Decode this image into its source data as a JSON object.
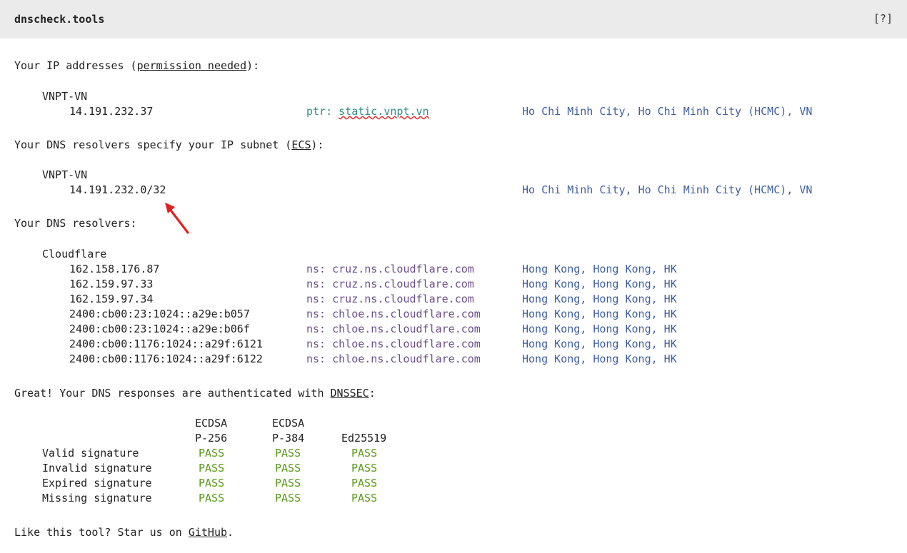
{
  "header": {
    "brand": "dnscheck.tools",
    "help": "[?]"
  },
  "ip_section": {
    "heading_before": "Your IP addresses (",
    "heading_link": "permission needed",
    "heading_after": "):",
    "provider": "VNPT-VN",
    "ip": "14.191.232.37",
    "ptr_label": "ptr: ",
    "ptr_value": "static.vnpt.vn",
    "location": "Ho Chi Minh City, Ho Chi Minh City (HCMC), VN"
  },
  "ecs_section": {
    "heading_before": "Your DNS resolvers specify your IP subnet (",
    "heading_link": "ECS",
    "heading_after": "):",
    "provider": "VNPT-VN",
    "subnet": "14.191.232.0/32",
    "location": "Ho Chi Minh City, Ho Chi Minh City (HCMC), VN"
  },
  "resolvers_section": {
    "heading": "Your DNS resolvers:",
    "provider": "Cloudflare",
    "rows": [
      {
        "ip": "162.158.176.87",
        "ns": "ns: cruz.ns.cloudflare.com",
        "location": "Hong Kong, Hong Kong, HK"
      },
      {
        "ip": "162.159.97.33",
        "ns": "ns: cruz.ns.cloudflare.com",
        "location": "Hong Kong, Hong Kong, HK"
      },
      {
        "ip": "162.159.97.34",
        "ns": "ns: cruz.ns.cloudflare.com",
        "location": "Hong Kong, Hong Kong, HK"
      },
      {
        "ip": "2400:cb00:23:1024::a29e:b057",
        "ns": "ns: chloe.ns.cloudflare.com",
        "location": "Hong Kong, Hong Kong, HK"
      },
      {
        "ip": "2400:cb00:23:1024::a29e:b06f",
        "ns": "ns: chloe.ns.cloudflare.com",
        "location": "Hong Kong, Hong Kong, HK"
      },
      {
        "ip": "2400:cb00:1176:1024::a29f:6121",
        "ns": "ns: chloe.ns.cloudflare.com",
        "location": "Hong Kong, Hong Kong, HK"
      },
      {
        "ip": "2400:cb00:1176:1024::a29f:6122",
        "ns": "ns: chloe.ns.cloudflare.com",
        "location": "Hong Kong, Hong Kong, HK"
      }
    ]
  },
  "dnssec_section": {
    "heading_before": "Great! Your DNS responses are authenticated with ",
    "heading_link": "DNSSEC",
    "heading_after": ":",
    "columns": [
      {
        "line1": "ECDSA",
        "line2": "P-256"
      },
      {
        "line1": "ECDSA",
        "line2": "P-384"
      },
      {
        "line1": "",
        "line2": "Ed25519"
      }
    ],
    "rows": [
      {
        "label": "Valid signature",
        "results": [
          "PASS",
          "PASS",
          "PASS"
        ]
      },
      {
        "label": "Invalid signature",
        "results": [
          "PASS",
          "PASS",
          "PASS"
        ]
      },
      {
        "label": "Expired signature",
        "results": [
          "PASS",
          "PASS",
          "PASS"
        ]
      },
      {
        "label": "Missing signature",
        "results": [
          "PASS",
          "PASS",
          "PASS"
        ]
      }
    ]
  },
  "footer": {
    "text_before": "Like this tool? Star us on ",
    "link": "GitHub",
    "text_after": "."
  },
  "colors": {
    "header_bg": "#ebebeb",
    "ptr": "#2e8b8b",
    "location": "#3f5f9f",
    "ns": "#6b4f8a",
    "pass": "#5a9a1a",
    "annotation_arrow": "#e02020"
  }
}
